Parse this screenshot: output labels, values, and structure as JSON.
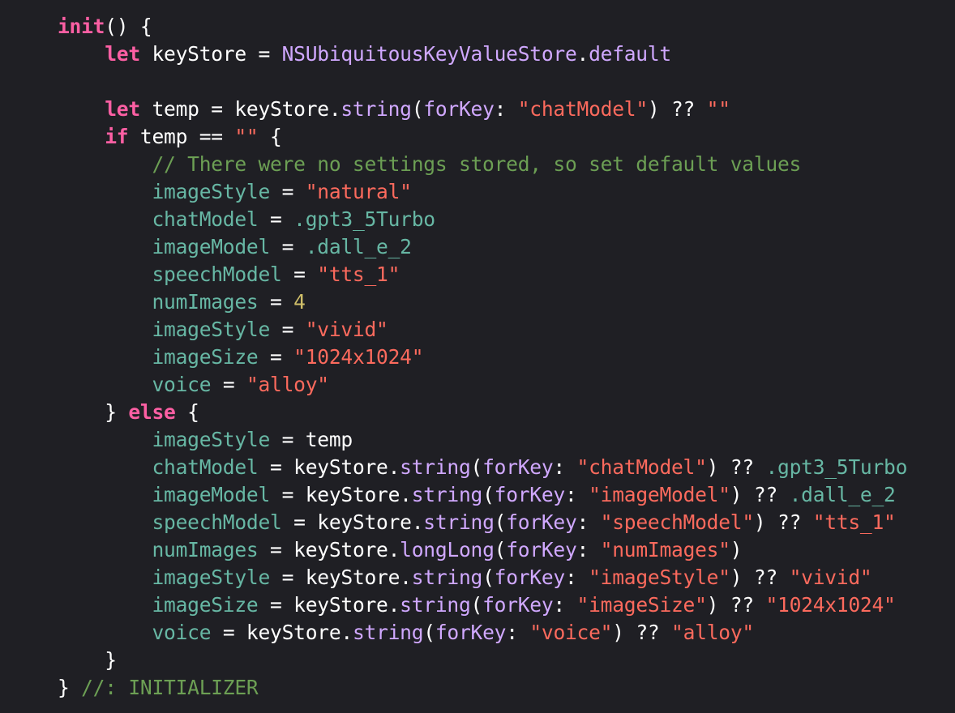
{
  "colors": {
    "background": "#1f1f24",
    "keyword": "#fc5fa3",
    "plain": "#ffffff",
    "property": "#67b7a4",
    "method": "#d0a8ff",
    "string": "#fc6a5d",
    "number": "#d0bf69",
    "comment": "#6c9f54"
  },
  "code": {
    "lines": [
      {
        "indent": 0,
        "tokens": [
          {
            "k": "kw",
            "t": "init"
          },
          {
            "k": "plain",
            "t": "() {"
          }
        ]
      },
      {
        "indent": 1,
        "tokens": [
          {
            "k": "kw",
            "t": "let"
          },
          {
            "k": "plain",
            "t": " keyStore = "
          },
          {
            "k": "type",
            "t": "NSUbiquitousKeyValueStore"
          },
          {
            "k": "plain",
            "t": "."
          },
          {
            "k": "type",
            "t": "default"
          }
        ]
      },
      {
        "indent": 0,
        "tokens": []
      },
      {
        "indent": 1,
        "tokens": [
          {
            "k": "kw",
            "t": "let"
          },
          {
            "k": "plain",
            "t": " temp = keyStore."
          },
          {
            "k": "type",
            "t": "string"
          },
          {
            "k": "plain",
            "t": "("
          },
          {
            "k": "type",
            "t": "forKey"
          },
          {
            "k": "plain",
            "t": ": "
          },
          {
            "k": "str",
            "t": "\"chatModel\""
          },
          {
            "k": "plain",
            "t": ") ?? "
          },
          {
            "k": "str",
            "t": "\"\""
          }
        ]
      },
      {
        "indent": 1,
        "tokens": [
          {
            "k": "kw",
            "t": "if"
          },
          {
            "k": "plain",
            "t": " temp == "
          },
          {
            "k": "str",
            "t": "\"\""
          },
          {
            "k": "plain",
            "t": " {"
          }
        ]
      },
      {
        "indent": 2,
        "tokens": [
          {
            "k": "cmt",
            "t": "// There were no settings stored, so set default values"
          }
        ]
      },
      {
        "indent": 2,
        "tokens": [
          {
            "k": "var",
            "t": "imageStyle"
          },
          {
            "k": "plain",
            "t": " = "
          },
          {
            "k": "str",
            "t": "\"natural\""
          }
        ]
      },
      {
        "indent": 2,
        "tokens": [
          {
            "k": "var",
            "t": "chatModel"
          },
          {
            "k": "plain",
            "t": " = "
          },
          {
            "k": "var",
            "t": ".gpt3_5Turbo"
          }
        ]
      },
      {
        "indent": 2,
        "tokens": [
          {
            "k": "var",
            "t": "imageModel"
          },
          {
            "k": "plain",
            "t": " = "
          },
          {
            "k": "var",
            "t": ".dall_e_2"
          }
        ]
      },
      {
        "indent": 2,
        "tokens": [
          {
            "k": "var",
            "t": "speechModel"
          },
          {
            "k": "plain",
            "t": " = "
          },
          {
            "k": "str",
            "t": "\"tts_1\""
          }
        ]
      },
      {
        "indent": 2,
        "tokens": [
          {
            "k": "var",
            "t": "numImages"
          },
          {
            "k": "plain",
            "t": " = "
          },
          {
            "k": "num",
            "t": "4"
          }
        ]
      },
      {
        "indent": 2,
        "tokens": [
          {
            "k": "var",
            "t": "imageStyle"
          },
          {
            "k": "plain",
            "t": " = "
          },
          {
            "k": "str",
            "t": "\"vivid\""
          }
        ]
      },
      {
        "indent": 2,
        "tokens": [
          {
            "k": "var",
            "t": "imageSize"
          },
          {
            "k": "plain",
            "t": " = "
          },
          {
            "k": "str",
            "t": "\"1024x1024\""
          }
        ]
      },
      {
        "indent": 2,
        "tokens": [
          {
            "k": "var",
            "t": "voice"
          },
          {
            "k": "plain",
            "t": " = "
          },
          {
            "k": "str",
            "t": "\"alloy\""
          }
        ]
      },
      {
        "indent": 1,
        "tokens": [
          {
            "k": "plain",
            "t": "} "
          },
          {
            "k": "kw",
            "t": "else"
          },
          {
            "k": "plain",
            "t": " {"
          }
        ]
      },
      {
        "indent": 2,
        "tokens": [
          {
            "k": "var",
            "t": "imageStyle"
          },
          {
            "k": "plain",
            "t": " = temp"
          }
        ]
      },
      {
        "indent": 2,
        "tokens": [
          {
            "k": "var",
            "t": "chatModel"
          },
          {
            "k": "plain",
            "t": " = keyStore."
          },
          {
            "k": "type",
            "t": "string"
          },
          {
            "k": "plain",
            "t": "("
          },
          {
            "k": "type",
            "t": "forKey"
          },
          {
            "k": "plain",
            "t": ": "
          },
          {
            "k": "str",
            "t": "\"chatModel\""
          },
          {
            "k": "plain",
            "t": ") ?? "
          },
          {
            "k": "var",
            "t": ".gpt3_5Turbo"
          }
        ]
      },
      {
        "indent": 2,
        "tokens": [
          {
            "k": "var",
            "t": "imageModel"
          },
          {
            "k": "plain",
            "t": " = keyStore."
          },
          {
            "k": "type",
            "t": "string"
          },
          {
            "k": "plain",
            "t": "("
          },
          {
            "k": "type",
            "t": "forKey"
          },
          {
            "k": "plain",
            "t": ": "
          },
          {
            "k": "str",
            "t": "\"imageModel\""
          },
          {
            "k": "plain",
            "t": ") ?? "
          },
          {
            "k": "var",
            "t": ".dall_e_2"
          }
        ]
      },
      {
        "indent": 2,
        "tokens": [
          {
            "k": "var",
            "t": "speechModel"
          },
          {
            "k": "plain",
            "t": " = keyStore."
          },
          {
            "k": "type",
            "t": "string"
          },
          {
            "k": "plain",
            "t": "("
          },
          {
            "k": "type",
            "t": "forKey"
          },
          {
            "k": "plain",
            "t": ": "
          },
          {
            "k": "str",
            "t": "\"speechModel\""
          },
          {
            "k": "plain",
            "t": ") ?? "
          },
          {
            "k": "str",
            "t": "\"tts_1\""
          }
        ]
      },
      {
        "indent": 2,
        "tokens": [
          {
            "k": "var",
            "t": "numImages"
          },
          {
            "k": "plain",
            "t": " = keyStore."
          },
          {
            "k": "type",
            "t": "longLong"
          },
          {
            "k": "plain",
            "t": "("
          },
          {
            "k": "type",
            "t": "forKey"
          },
          {
            "k": "plain",
            "t": ": "
          },
          {
            "k": "str",
            "t": "\"numImages\""
          },
          {
            "k": "plain",
            "t": ")"
          }
        ]
      },
      {
        "indent": 2,
        "tokens": [
          {
            "k": "var",
            "t": "imageStyle"
          },
          {
            "k": "plain",
            "t": " = keyStore."
          },
          {
            "k": "type",
            "t": "string"
          },
          {
            "k": "plain",
            "t": "("
          },
          {
            "k": "type",
            "t": "forKey"
          },
          {
            "k": "plain",
            "t": ": "
          },
          {
            "k": "str",
            "t": "\"imageStyle\""
          },
          {
            "k": "plain",
            "t": ") ?? "
          },
          {
            "k": "str",
            "t": "\"vivid\""
          }
        ]
      },
      {
        "indent": 2,
        "tokens": [
          {
            "k": "var",
            "t": "imageSize"
          },
          {
            "k": "plain",
            "t": " = keyStore."
          },
          {
            "k": "type",
            "t": "string"
          },
          {
            "k": "plain",
            "t": "("
          },
          {
            "k": "type",
            "t": "forKey"
          },
          {
            "k": "plain",
            "t": ": "
          },
          {
            "k": "str",
            "t": "\"imageSize\""
          },
          {
            "k": "plain",
            "t": ") ?? "
          },
          {
            "k": "str",
            "t": "\"1024x1024\""
          }
        ]
      },
      {
        "indent": 2,
        "tokens": [
          {
            "k": "var",
            "t": "voice"
          },
          {
            "k": "plain",
            "t": " = keyStore."
          },
          {
            "k": "type",
            "t": "string"
          },
          {
            "k": "plain",
            "t": "("
          },
          {
            "k": "type",
            "t": "forKey"
          },
          {
            "k": "plain",
            "t": ": "
          },
          {
            "k": "str",
            "t": "\"voice\""
          },
          {
            "k": "plain",
            "t": ") ?? "
          },
          {
            "k": "str",
            "t": "\"alloy\""
          }
        ]
      },
      {
        "indent": 1,
        "tokens": [
          {
            "k": "plain",
            "t": "}"
          }
        ]
      },
      {
        "indent": 0,
        "tokens": [
          {
            "k": "plain",
            "t": "} "
          },
          {
            "k": "cmt",
            "t": "//: INITIALIZER"
          }
        ]
      }
    ]
  }
}
